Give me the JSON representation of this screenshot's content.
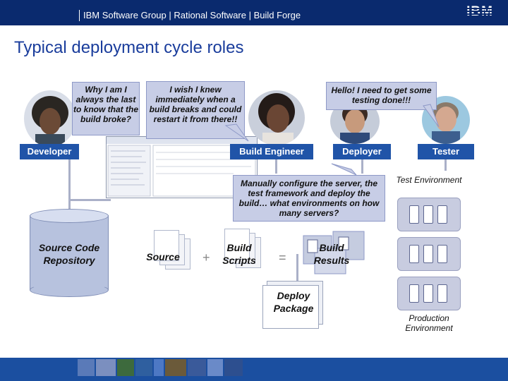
{
  "header": {
    "breadcrumb": "IBM Software Group | Rational Software | Build Forge",
    "logo_text": "IBM"
  },
  "title": "Typical deployment cycle roles",
  "bubbles": {
    "developer": "Why I am I always the last to know that the build broke?",
    "build_engineer": "I wish I knew immediately when a build breaks and could restart it from there!!",
    "deployer": "Hello!  I need to get some testing done!!!",
    "manual": "Manually configure the server, the test framework and deploy the build… what environments on how many servers?"
  },
  "roles": {
    "developer": "Developer",
    "build_engineer": "Build Engineer",
    "deployer": "Deployer",
    "tester": "Tester"
  },
  "flow": {
    "repository": "Source Code Repository",
    "source": "Source",
    "plus": "+",
    "build_scripts": "Build Scripts",
    "equals": "=",
    "build_results": "Build Results",
    "deploy_package": "Deploy Package"
  },
  "environments": {
    "test": "Test Environment",
    "production": "Production Environment"
  },
  "colors": {
    "header_bg": "#0a2a6e",
    "title": "#1a3d9c",
    "role_label_bg": "#2054a8",
    "bubble_bg": "#c7cde6"
  }
}
